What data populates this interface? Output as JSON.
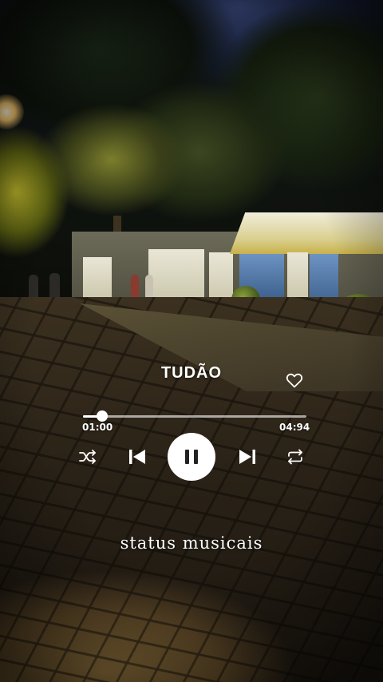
{
  "player": {
    "song_title": "TUDÃO",
    "elapsed": "01:00",
    "duration": "04:94",
    "progress_fraction": 0.084,
    "liked": false
  },
  "controls": {
    "shuffle_icon": "shuffle-icon",
    "previous_icon": "skip-previous-icon",
    "play_state_icon": "pause-icon",
    "next_icon": "skip-next-icon",
    "repeat_icon": "repeat-icon",
    "like_icon": "heart-outline-icon"
  },
  "overlay": {
    "caption": "status musicais"
  },
  "colors": {
    "accent": "#ffffff",
    "play_icon": "#222222"
  }
}
